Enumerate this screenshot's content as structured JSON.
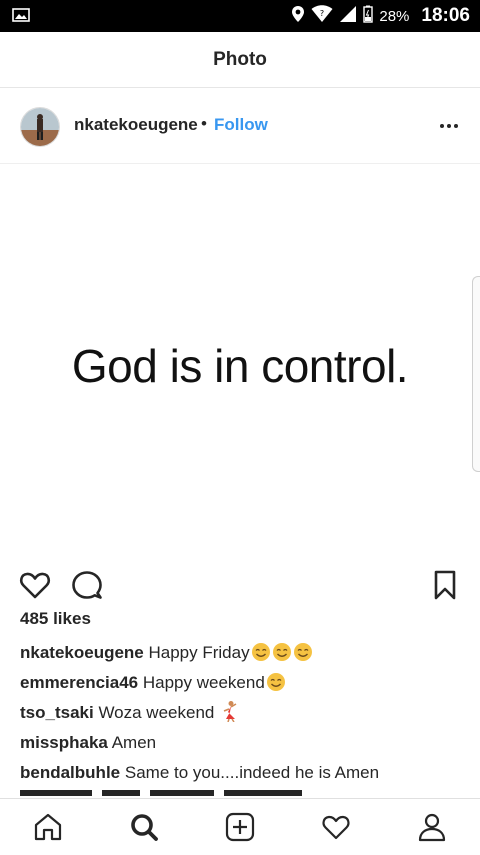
{
  "status_bar": {
    "battery_percent": "28%",
    "time": "18:06"
  },
  "header": {
    "title": "Photo"
  },
  "post": {
    "username": "nkatekoeugene",
    "dot": "•",
    "follow_label": "Follow",
    "image_text": "God is in control.",
    "likes": "485 likes"
  },
  "comments": [
    {
      "user": "nkatekoeugene",
      "text": "Happy Friday",
      "emoji": [
        "smiling-face-icon",
        "smiling-face-icon",
        "smiling-face-icon"
      ]
    },
    {
      "user": "emmerencia46",
      "text": "Happy weekend",
      "emoji": [
        "smiling-face-icon"
      ]
    },
    {
      "user": "tso_tsaki",
      "text": "Woza weekend ",
      "emoji": [
        "dancer-icon"
      ]
    },
    {
      "user": "missphaka",
      "text": "Amen",
      "emoji": []
    },
    {
      "user": "bendalbuhle",
      "text": "Same to you....indeed he is Amen",
      "emoji": []
    }
  ],
  "icons": {
    "like": "heart-icon",
    "comment": "comment-bubble-icon",
    "save": "bookmark-icon",
    "more": "more-options-icon",
    "nav": [
      "home-icon",
      "search-icon",
      "add-post-icon",
      "activity-heart-icon",
      "profile-icon"
    ]
  },
  "colors": {
    "follow": "#3897f0",
    "text": "#262626",
    "status_bar": "#000000",
    "emoji": "#f5c242"
  }
}
